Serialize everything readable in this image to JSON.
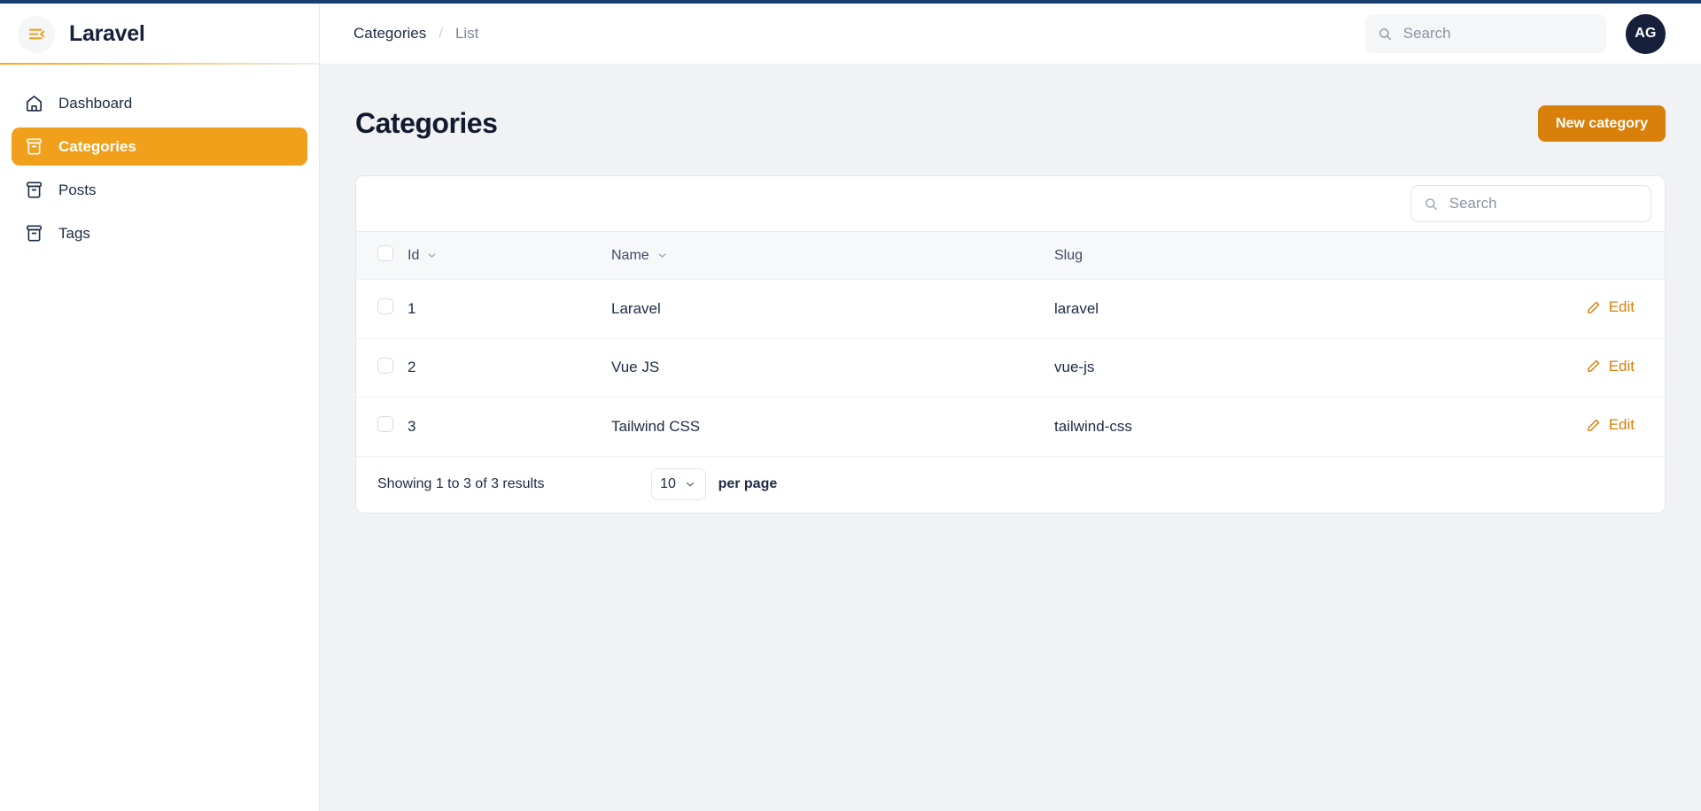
{
  "brand": {
    "name": "Laravel",
    "menu_icon": "menu-collapse-icon"
  },
  "sidebar": {
    "items": [
      {
        "label": "Dashboard",
        "icon": "home-icon",
        "active": false
      },
      {
        "label": "Categories",
        "icon": "archive-box-icon",
        "active": true
      },
      {
        "label": "Posts",
        "icon": "archive-box-icon",
        "active": false
      },
      {
        "label": "Tags",
        "icon": "archive-box-icon",
        "active": false
      }
    ]
  },
  "topbar": {
    "breadcrumb": {
      "parent": "Categories",
      "separator": "/",
      "current": "List"
    },
    "search": {
      "value": "",
      "placeholder": "Search",
      "icon": "search-icon"
    },
    "avatar": {
      "initials": "AG"
    }
  },
  "page": {
    "title": "Categories",
    "new_button": "New category"
  },
  "table": {
    "search": {
      "value": "",
      "placeholder": "Search",
      "icon": "search-icon"
    },
    "columns": [
      {
        "key": "check",
        "label": "",
        "sortable": false
      },
      {
        "key": "id",
        "label": "Id",
        "sortable": true
      },
      {
        "key": "name",
        "label": "Name",
        "sortable": true
      },
      {
        "key": "slug",
        "label": "Slug",
        "sortable": false
      },
      {
        "key": "actions",
        "label": "",
        "sortable": false
      }
    ],
    "rows": [
      {
        "id": "1",
        "name": "Laravel",
        "slug": "laravel",
        "action": "Edit"
      },
      {
        "id": "2",
        "name": "Vue JS",
        "slug": "vue-js",
        "action": "Edit"
      },
      {
        "id": "3",
        "name": "Tailwind CSS",
        "slug": "tailwind-css",
        "action": "Edit"
      }
    ],
    "footer": {
      "results_text": "Showing 1 to 3 of 3 results",
      "per_page_value": "10",
      "per_page_label": "per page"
    }
  },
  "colors": {
    "accent": "#f0a01b",
    "accent_dark": "#d9800b",
    "navy": "#17203a",
    "top_border": "#17406e",
    "page_bg": "#f1f2f4"
  }
}
